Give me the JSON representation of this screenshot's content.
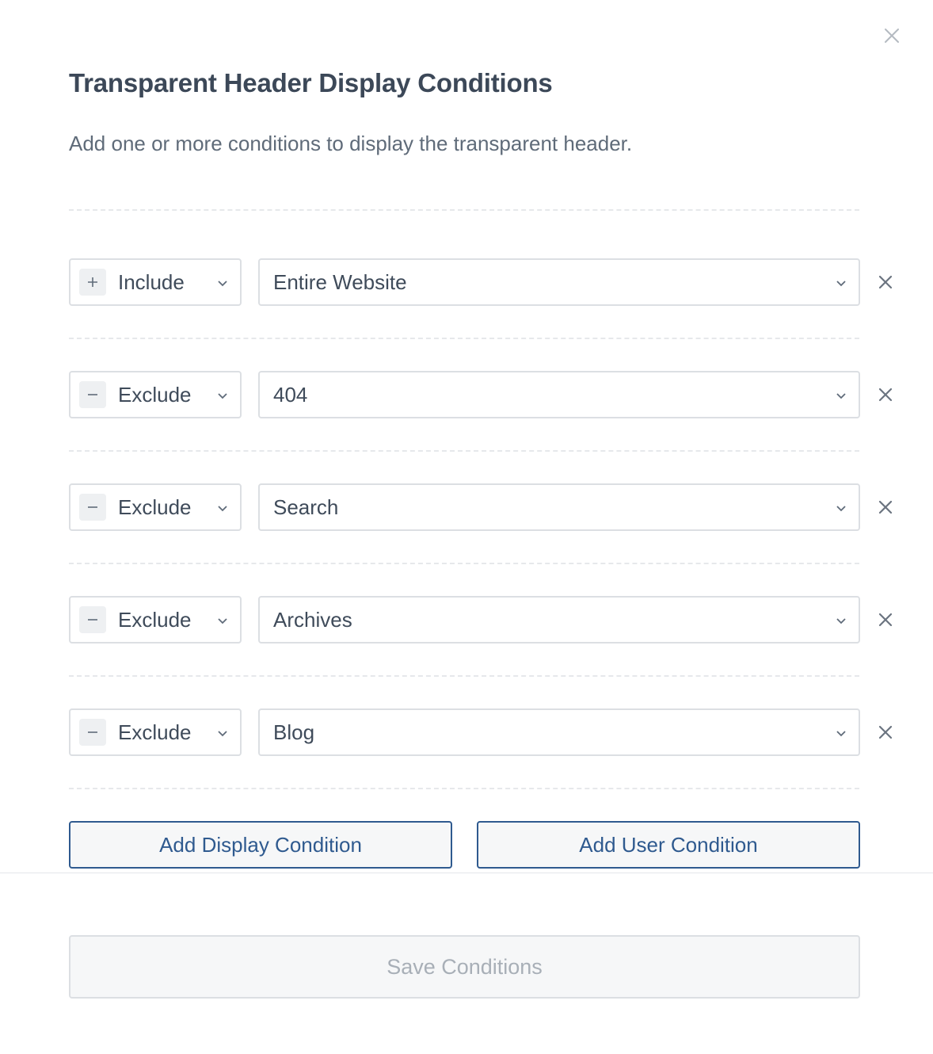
{
  "dialog": {
    "title": "Transparent Header Display Conditions",
    "subtitle": "Add one or more conditions to display the transparent header."
  },
  "conditions": [
    {
      "type": "Include",
      "type_icon": "plus-icon",
      "value": "Entire Website"
    },
    {
      "type": "Exclude",
      "type_icon": "minus-icon",
      "value": "404"
    },
    {
      "type": "Exclude",
      "type_icon": "minus-icon",
      "value": "Search"
    },
    {
      "type": "Exclude",
      "type_icon": "minus-icon",
      "value": "Archives"
    },
    {
      "type": "Exclude",
      "type_icon": "minus-icon",
      "value": "Blog"
    }
  ],
  "actions": {
    "add_display": "Add Display Condition",
    "add_user": "Add User Condition",
    "save": "Save Conditions"
  },
  "colors": {
    "accent": "#2f5a8f",
    "text": "#3f4b5a",
    "disabled_text": "#a8afb7"
  }
}
